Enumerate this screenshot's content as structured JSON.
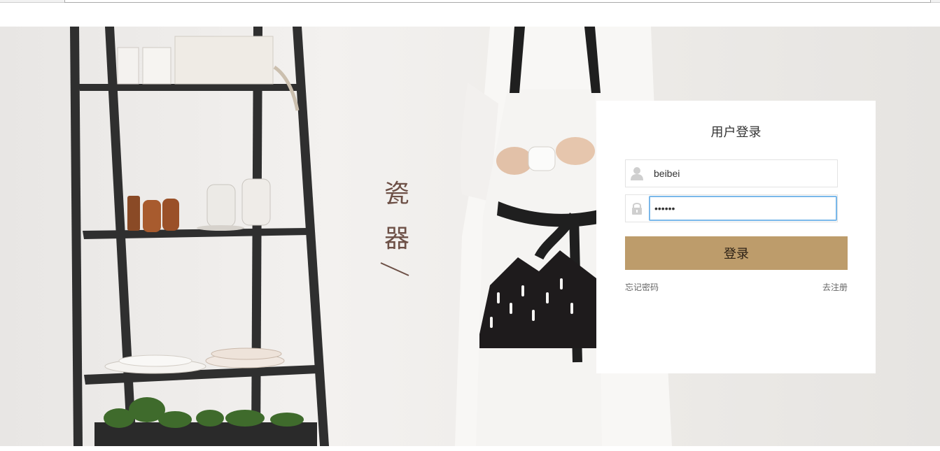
{
  "brand": {
    "chars": [
      "瓷",
      "器"
    ]
  },
  "login": {
    "title": "用户登录",
    "username_value": "beibei",
    "password_value": "••••••",
    "submit_label": "登录",
    "forgot_label": "忘记密码",
    "register_label": "去注册"
  },
  "colors": {
    "accent": "#bd9c6b",
    "brand_text": "#6d5046",
    "focus_border": "#7ab8ea",
    "panel_bg": "#ffffff"
  },
  "icons": {
    "username": "user-icon",
    "password": "lock-icon"
  }
}
